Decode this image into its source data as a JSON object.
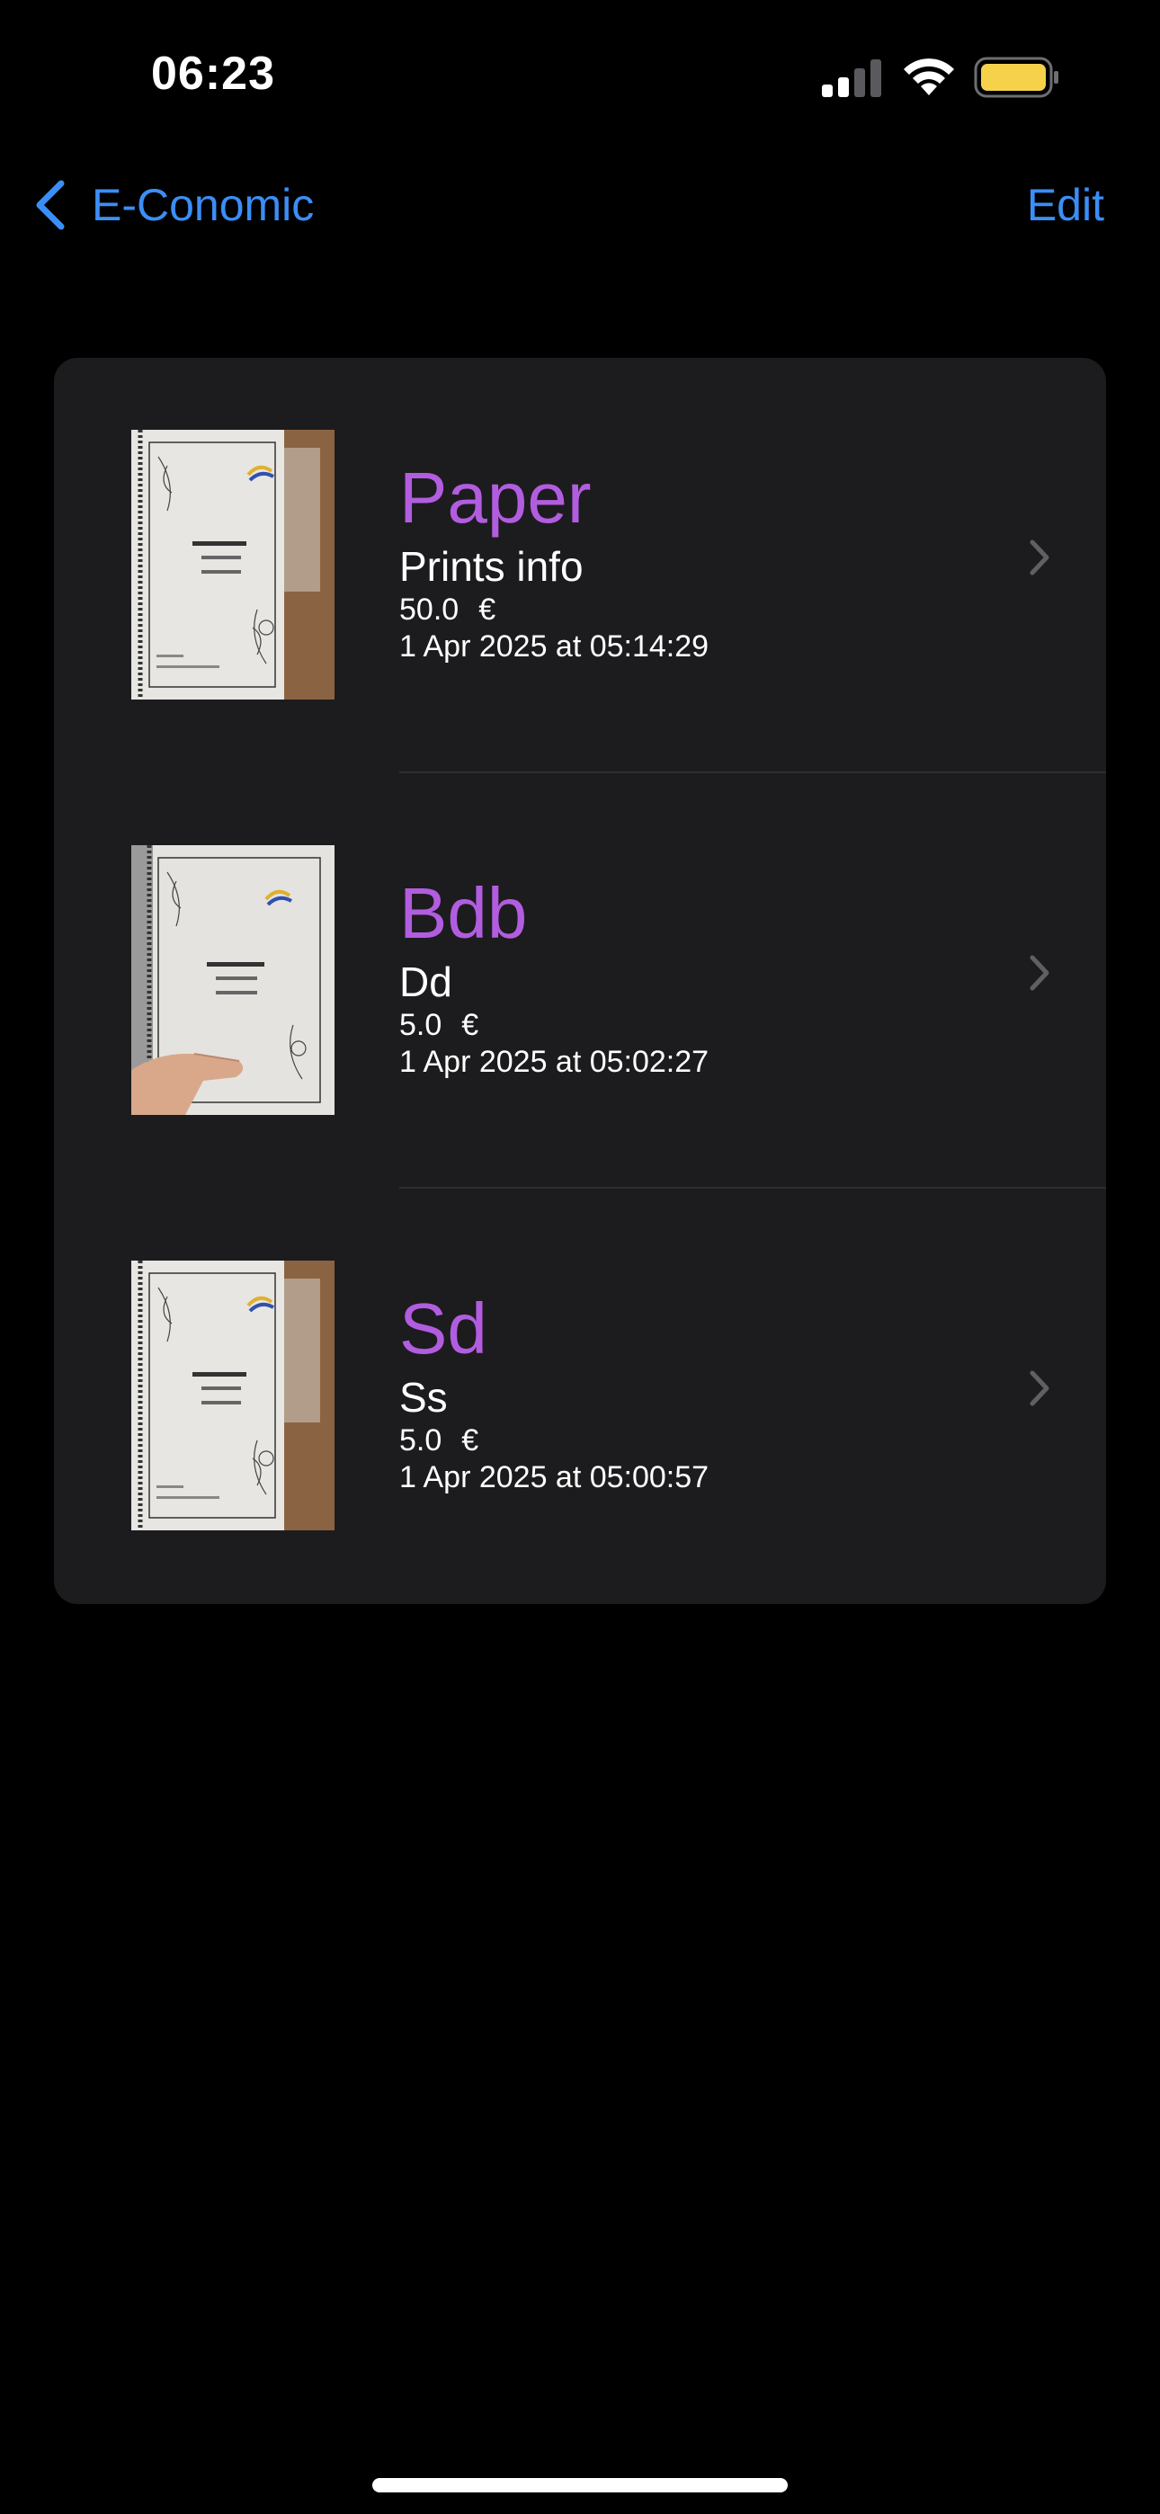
{
  "status_bar": {
    "time": "06:23",
    "icons": [
      "cellular-signal-icon",
      "wifi-icon",
      "battery-icon"
    ],
    "battery_color": "#f5d24a"
  },
  "nav": {
    "back_label": "E-Conomic",
    "edit_label": "Edit",
    "accent_color": "#3b8ef5"
  },
  "list": {
    "title_color": "#b25de0",
    "items": [
      {
        "title": "Paper",
        "subtitle": "Prints info",
        "price": "50.0",
        "currency": "€",
        "date": "1 Apr 2025 at 05:14:29"
      },
      {
        "title": "Bdb",
        "subtitle": "Dd",
        "price": "5.0",
        "currency": "€",
        "date": "1 Apr 2025 at 05:02:27"
      },
      {
        "title": "Sd",
        "subtitle": "Ss",
        "price": "5.0",
        "currency": "€",
        "date": "1 Apr 2025 at 05:00:57"
      }
    ]
  }
}
